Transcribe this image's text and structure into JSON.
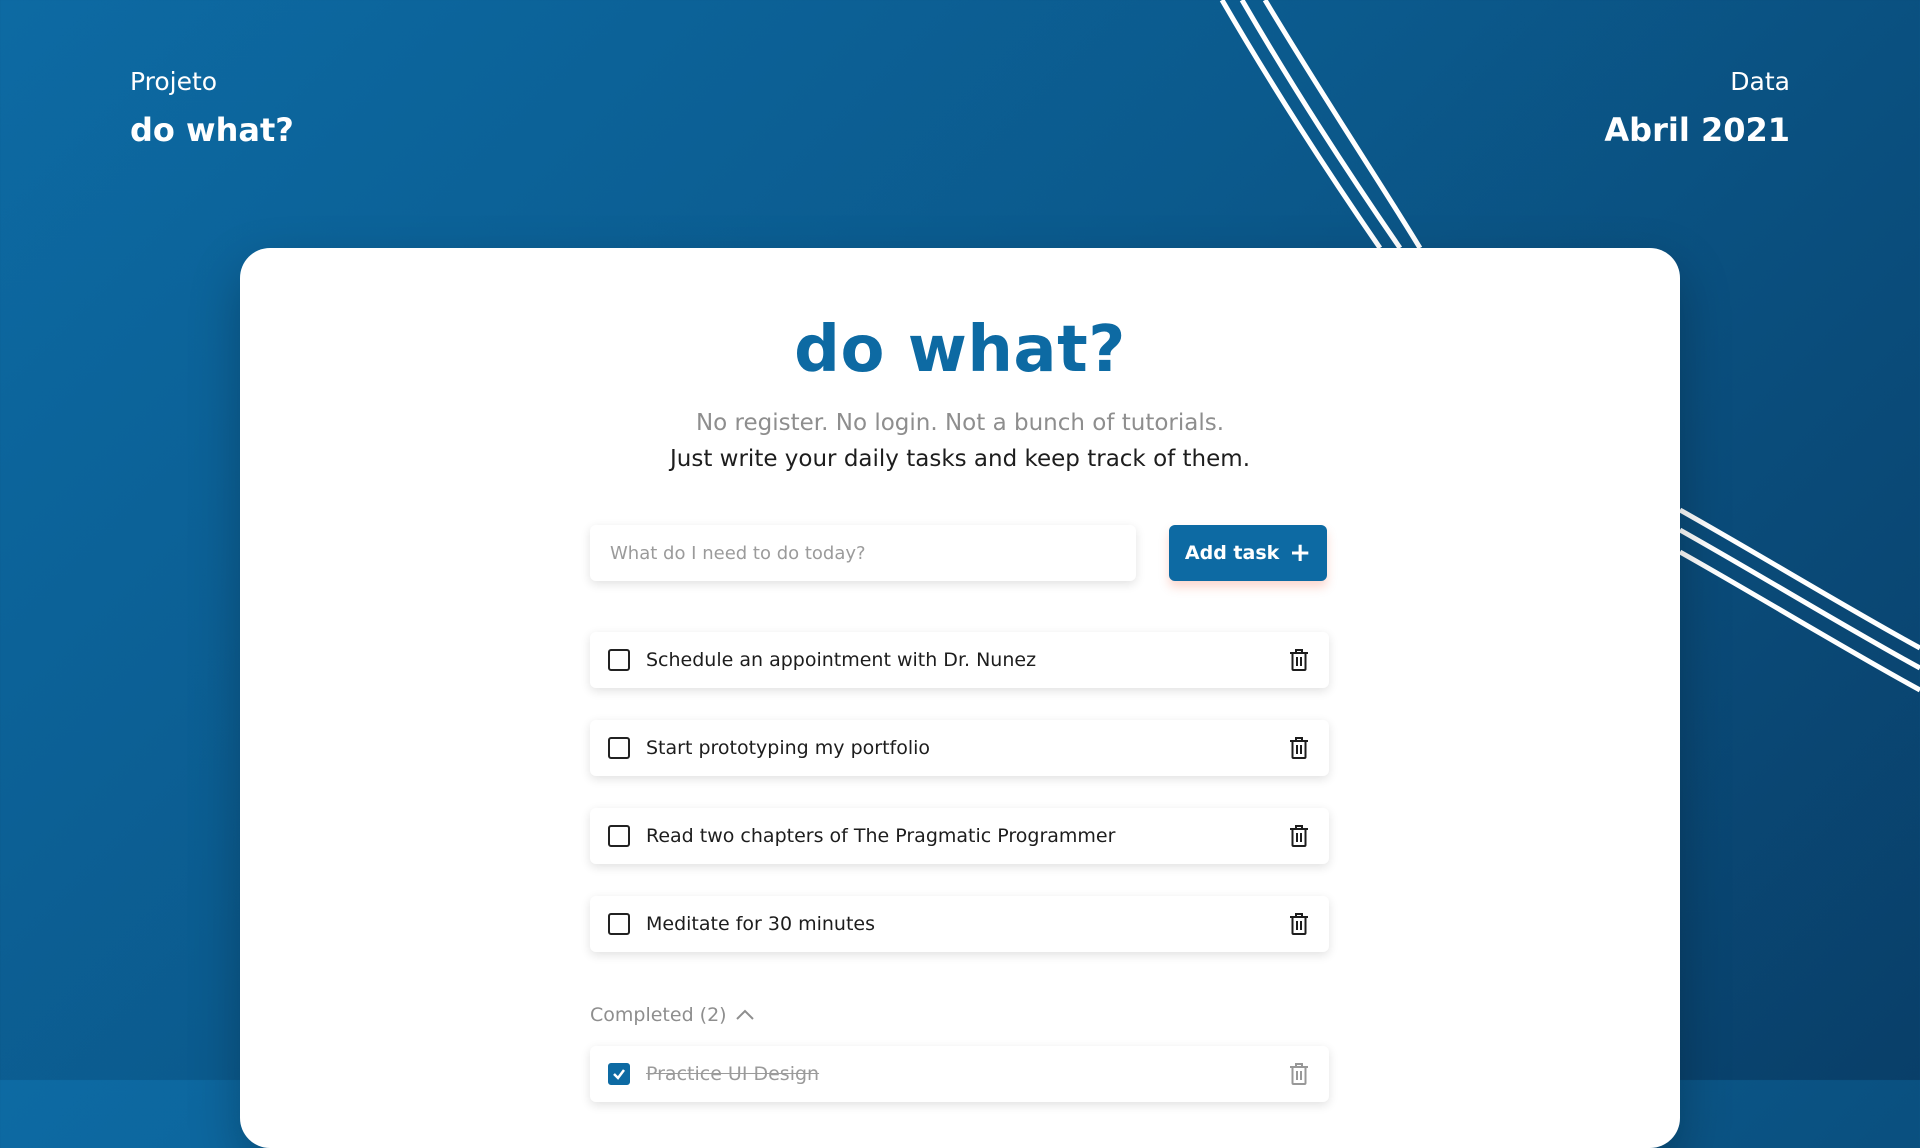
{
  "header": {
    "project_label": "Projeto",
    "project_name": "do what?",
    "date_label": "Data",
    "date_value": "Abril 2021"
  },
  "app": {
    "title": "do what?",
    "tagline_1": "No register. No login. Not a bunch of tutorials.",
    "tagline_2": "Just write your daily tasks and keep track of them."
  },
  "form": {
    "placeholder": "What do I need to do today?",
    "value": "",
    "add_label": "Add task",
    "add_icon": "plus-icon"
  },
  "tasks": [
    {
      "text": "Schedule an appointment with Dr. Nunez",
      "checked": false
    },
    {
      "text": "Start prototyping my portfolio",
      "checked": false
    },
    {
      "text": "Read two chapters of The Pragmatic Programmer",
      "checked": false
    },
    {
      "text": "Meditate for 30 minutes",
      "checked": false
    }
  ],
  "completed": {
    "label": "Completed (2)",
    "icon": "chevron-up-icon",
    "items": [
      {
        "text": "Practice UI Design",
        "checked": true
      }
    ]
  },
  "colors": {
    "brand": "#0d6aa3",
    "background_dark": "#093f69",
    "muted_text": "#8e8e8e"
  }
}
